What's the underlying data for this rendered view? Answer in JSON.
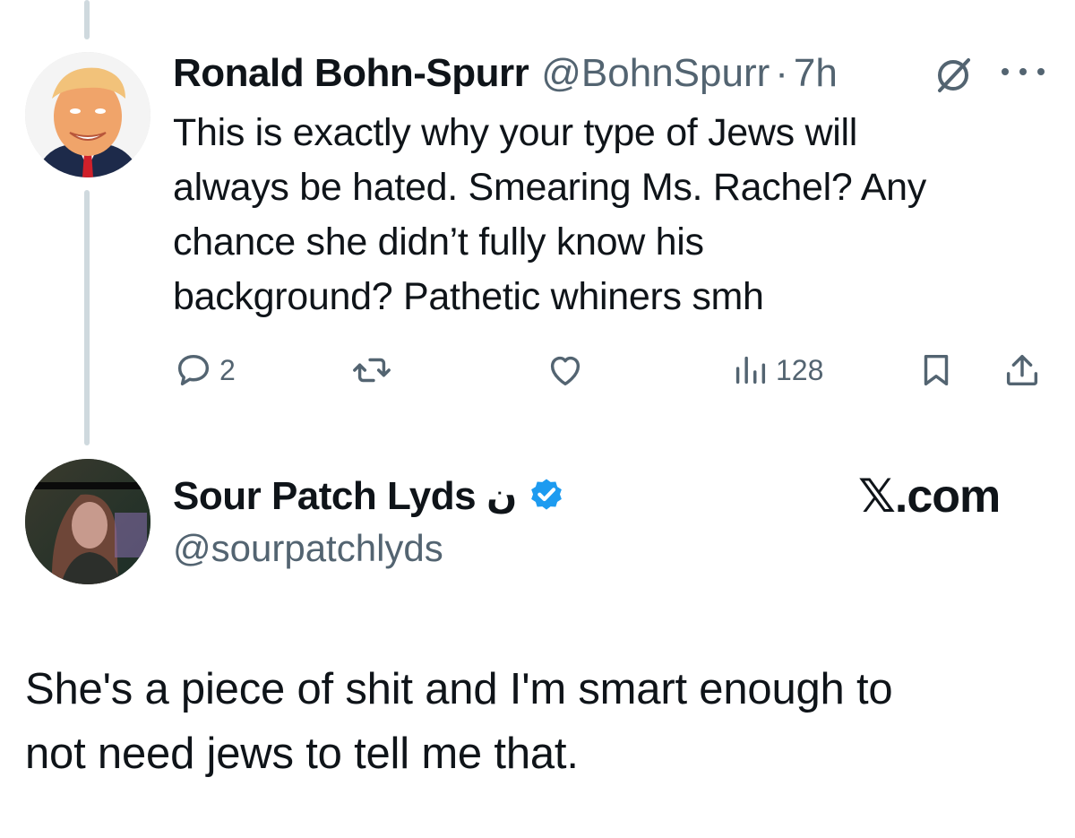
{
  "parent_tweet": {
    "display_name": "Ronald Bohn-Spurr",
    "handle": "@BohnSpurr",
    "separator": "·",
    "time": "7h",
    "icons": {
      "grok": "grok-slash-icon",
      "more": "more-dots-icon"
    },
    "text": "This is exactly why your type of Jews will\nalways be hated. Smearing Ms. Rachel? Any\nchance she didn’t fully know his\nbackground? Pathetic whiners smh",
    "actions": {
      "reply_count": "2",
      "views_count": "128"
    }
  },
  "reply_tweet": {
    "display_name": "Sour Patch Lyds",
    "name_suffix": "ن",
    "verified": true,
    "handle": "@sourpatchlyds",
    "brand": "𝕏.com",
    "text": "She's a piece of shit and I'm smart enough to\nnot need jews to tell me that."
  },
  "colors": {
    "text": "#0f1419",
    "secondary": "#536471",
    "verified_blue": "#1d9bf0",
    "thread_line": "#cfd9de"
  }
}
